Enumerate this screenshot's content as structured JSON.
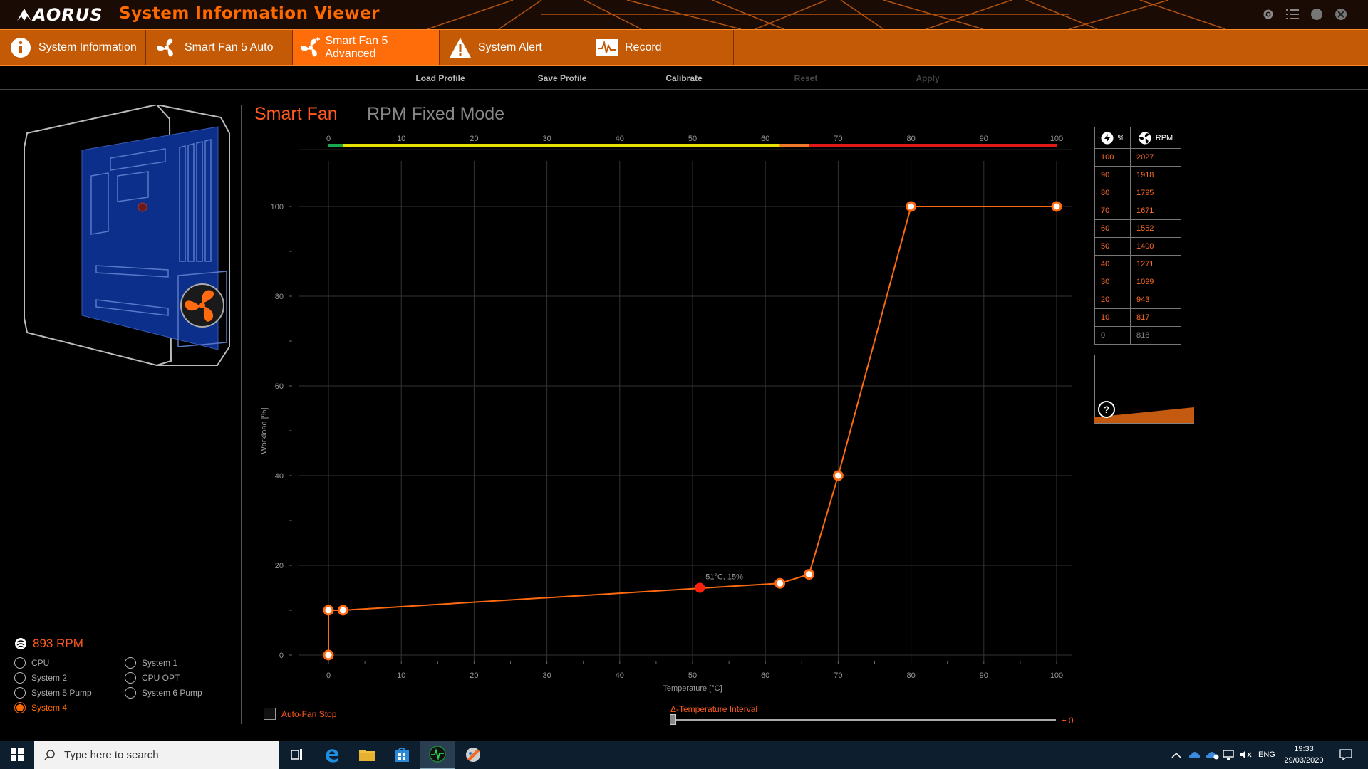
{
  "titlebar": {
    "logo": "AORUS",
    "title": "System Information Viewer"
  },
  "tabs": [
    {
      "label": "System Information",
      "icon": "info-icon",
      "active": false
    },
    {
      "label": "Smart Fan 5 Auto",
      "icon": "fan-icon",
      "active": false
    },
    {
      "label": "Smart Fan 5 Advanced",
      "icon": "fan-advanced-icon",
      "active": true
    },
    {
      "label": "System Alert",
      "icon": "warning-icon",
      "active": false
    },
    {
      "label": "Record",
      "icon": "record-icon",
      "active": false
    }
  ],
  "toolbar": {
    "load_profile": "Load Profile",
    "save_profile": "Save Profile",
    "calibrate": "Calibrate",
    "reset": "Reset",
    "apply": "Apply"
  },
  "modes": {
    "smart_fan": "Smart Fan",
    "rpm_fixed": "RPM Fixed Mode"
  },
  "fan_status": {
    "rpm": "893 RPM",
    "fans": [
      {
        "label": "CPU",
        "selected": false
      },
      {
        "label": "System 1",
        "selected": false
      },
      {
        "label": "System 2",
        "selected": false
      },
      {
        "label": "CPU OPT",
        "selected": false
      },
      {
        "label": "System 5 Pump",
        "selected": false
      },
      {
        "label": "System 6 Pump",
        "selected": false
      },
      {
        "label": "System 4",
        "selected": true
      }
    ]
  },
  "chart_data": {
    "type": "line",
    "xlabel": "Temperature [°C]",
    "ylabel": "Workload [%]",
    "xlim": [
      0,
      100
    ],
    "ylim": [
      0,
      100
    ],
    "x_ticks": [
      0,
      10,
      20,
      30,
      40,
      50,
      60,
      70,
      80,
      90,
      100
    ],
    "y_ticks": [
      0,
      20,
      40,
      60,
      80,
      100
    ],
    "grid": true,
    "series": [
      {
        "x": [
          0,
          0,
          2,
          62,
          66,
          70,
          80,
          100
        ],
        "y": [
          0,
          10,
          10,
          16,
          18,
          40,
          100,
          100
        ]
      }
    ],
    "current_point": {
      "x": 51,
      "y": 15,
      "label": "51°C, 15%"
    },
    "temp_bar": [
      {
        "from": 0,
        "to": 2,
        "color": "#1aa84a"
      },
      {
        "from": 2,
        "to": 62,
        "color": "#e8e000"
      },
      {
        "from": 62,
        "to": 66,
        "color": "#f07a2a"
      },
      {
        "from": 66,
        "to": 100,
        "color": "#e01818"
      }
    ],
    "colors": {
      "line": "#ff6a10",
      "current": "#ff2010",
      "grid": "#333333"
    }
  },
  "rpm_table": {
    "header_percent": "%",
    "header_rpm": "RPM",
    "rows": [
      {
        "percent": "100",
        "rpm": "2027"
      },
      {
        "percent": "90",
        "rpm": "1918"
      },
      {
        "percent": "80",
        "rpm": "1795"
      },
      {
        "percent": "70",
        "rpm": "1671"
      },
      {
        "percent": "60",
        "rpm": "1552"
      },
      {
        "percent": "50",
        "rpm": "1400"
      },
      {
        "percent": "40",
        "rpm": "1271"
      },
      {
        "percent": "30",
        "rpm": "1099"
      },
      {
        "percent": "20",
        "rpm": "943"
      },
      {
        "percent": "10",
        "rpm": "817"
      },
      {
        "percent": "0",
        "rpm": "818"
      }
    ]
  },
  "controls": {
    "auto_fan_stop": "Auto-Fan Stop",
    "delta_label": "Δ-Temperature Interval",
    "delta_value": "± 0"
  },
  "taskbar": {
    "search_placeholder": "Type here to search",
    "language": "ENG",
    "time": "19:33",
    "date": "29/03/2020"
  }
}
